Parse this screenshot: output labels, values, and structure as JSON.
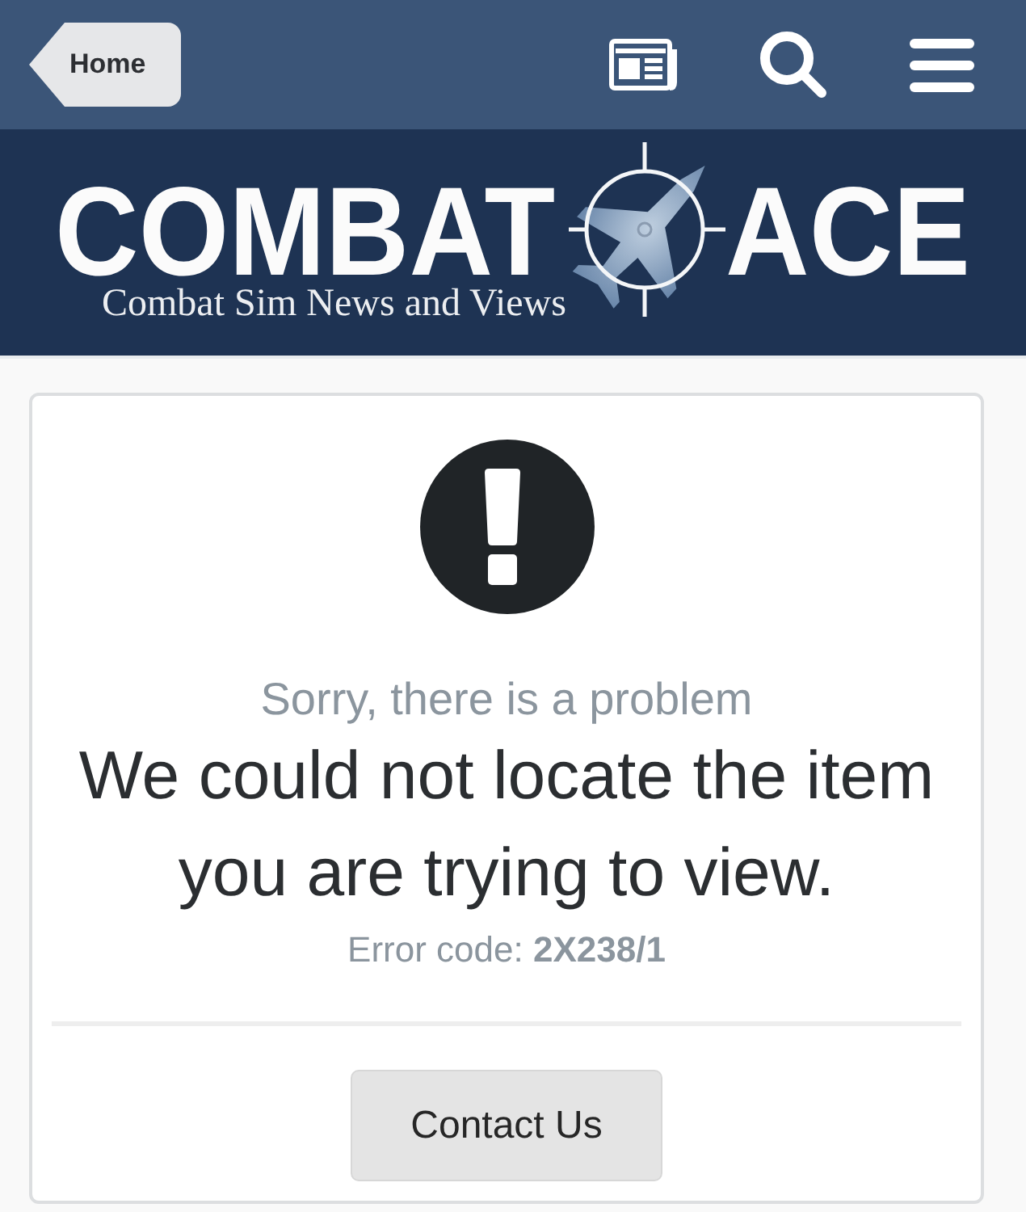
{
  "top_bar": {
    "home_button": "Home"
  },
  "logo": {
    "word_left": "COMBAT",
    "word_right": "ACE",
    "tagline": "Combat Sim News and Views"
  },
  "error": {
    "subtitle": "Sorry, there is a problem",
    "message": "We could not locate the item you are trying to view.",
    "code_line": "Error code: **2X238/1**",
    "button": "Contact Us"
  }
}
